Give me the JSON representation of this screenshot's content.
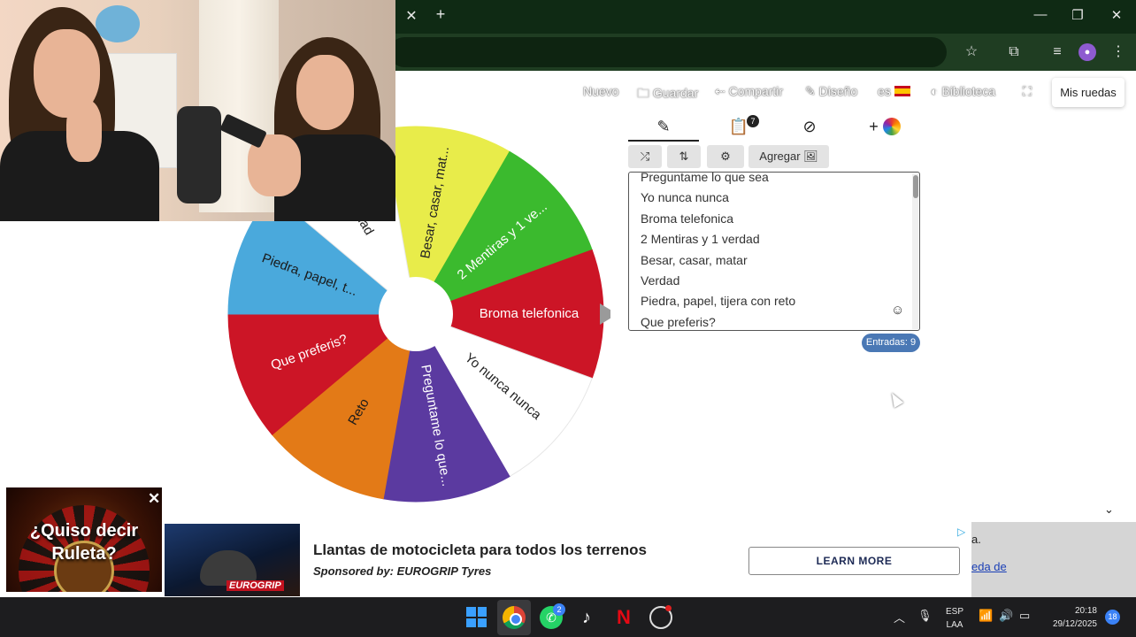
{
  "browser": {
    "tab_close": "✕",
    "tab_new": "+",
    "window_controls": {
      "minimize": "—",
      "restore": "❐",
      "close": "✕"
    },
    "toolbar_icons": [
      "star-icon",
      "extensions-icon",
      "media-icon",
      "profile-icon",
      "menu-icon"
    ]
  },
  "page_toolbar": {
    "items": [
      "Nuevo",
      "Guardar",
      "Compartir",
      "Diseño",
      "es",
      "Biblioteca"
    ],
    "fullscreen_icon": "fullscreen-icon",
    "mis_ruedas": "Mis ruedas"
  },
  "wheel": {
    "segments": [
      {
        "label": "Besar, casar, mat...",
        "color": "#e8ec4a"
      },
      {
        "label": "2 Mentiras y 1 ve...",
        "color": "#3bba2e"
      },
      {
        "label": "Broma telefonica",
        "color": "#cc1526"
      },
      {
        "label": "Yo nunca nunca",
        "color": "#ffffff"
      },
      {
        "label": "Preguntame lo que...",
        "color": "#5b3aa0"
      },
      {
        "label": "Reto",
        "color": "#e37a17"
      },
      {
        "label": "Que preferis?",
        "color": "#cc1526"
      },
      {
        "label": "Piedra, papel, t...",
        "color": "#4aa9dc"
      },
      {
        "label": "Verdad",
        "color": "#ffffff"
      }
    ]
  },
  "editor": {
    "tabs": {
      "edit": "edit-icon",
      "results": "clipboard-icon",
      "results_count": "7",
      "hide": "eye-off-icon",
      "add": "+"
    },
    "buttons": {
      "shuffle": "shuffle-icon",
      "sort": "sort-icon",
      "advanced": "gear-icon",
      "add_image": "Agregar"
    },
    "entries": [
      "Preguntame lo que sea",
      "Yo nunca nunca",
      "Broma telefonica",
      "2 Mentiras y 1 verdad",
      "Besar, casar, matar",
      "Verdad",
      "Piedra, papel, tijera con reto",
      "Que preferis?"
    ],
    "count_label": "Entradas: 9"
  },
  "popup_ad": {
    "text_line1": "¿Quiso decir",
    "text_line2": "Ruleta?",
    "close": "✕"
  },
  "banner_ad": {
    "brand": "EUROGRIP",
    "title": "Llantas de motocicleta para todos los terrenos",
    "sponsor": "Sponsored by: EUROGRIP Tyres",
    "button": "LEARN MORE",
    "adchoices": "▷"
  },
  "behind_ad": {
    "text": "a.",
    "link": "eda de"
  },
  "taskbar": {
    "whatsapp_badge": "2",
    "tiktok": "♪",
    "netflix": "N",
    "lang_line1": "ESP",
    "lang_line2": "LAA",
    "time": "20:18",
    "date": "29/12/2025",
    "notifications": "18"
  }
}
